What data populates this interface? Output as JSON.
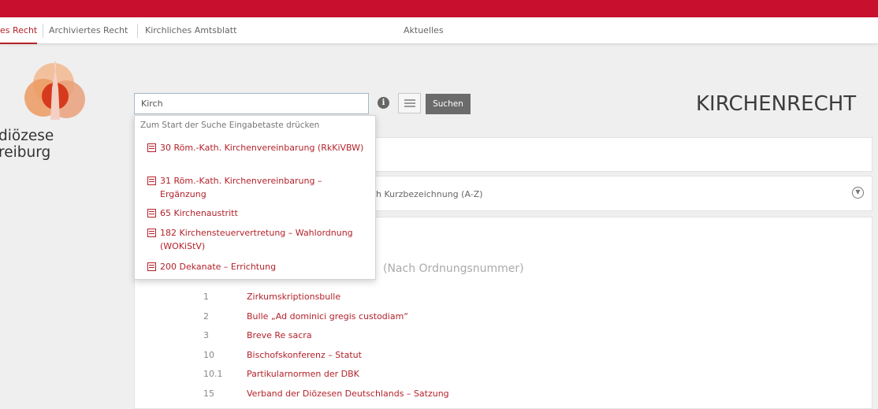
{
  "nav": {
    "items": [
      {
        "label": "es Recht",
        "active": true
      },
      {
        "label": "Archiviertes Recht",
        "active": false
      },
      {
        "label": "Kirchliches Amtsblatt",
        "active": false
      },
      {
        "label": "Aktuelles",
        "active": false
      }
    ]
  },
  "logo": {
    "line1": "diözese",
    "line2": "reiburg"
  },
  "search": {
    "value": "Kirch",
    "placeholder": "",
    "button_label": "Suchen",
    "info_icon": "info-icon",
    "list_icon": "list-icon"
  },
  "page_title": "KIRCHENRECHT",
  "sort_label": "h Kurzbezeichnung (A-Z)",
  "section_subtitle": "(Nach Ordnungsnummer)",
  "dropdown": {
    "hint": "Zum Start der Suche Eingabetaste drücken",
    "items": [
      {
        "label": "30 Röm.-Kath. Kirchenvereinbarung (RkKiVBW)"
      },
      {
        "label": "31 Röm.-Kath. Kirchenvereinbarung – Ergänzung"
      },
      {
        "label": "65 Kirchenaustritt"
      },
      {
        "label": "182 Kirchensteuervertretung – Wahlordnung (WOKiStV)"
      },
      {
        "label": "200 Dekanate – Errichtung"
      }
    ]
  },
  "laws": [
    {
      "num": "1",
      "title": "Zirkumskriptionsbulle"
    },
    {
      "num": "2",
      "title": "Bulle „Ad dominici gregis custodiam“"
    },
    {
      "num": "3",
      "title": "Breve Re sacra"
    },
    {
      "num": "10",
      "title": "Bischofskonferenz – Statut"
    },
    {
      "num": "10.1",
      "title": "Partikularnormen der DBK"
    },
    {
      "num": "15",
      "title": "Verband der Diözesen Deutschlands – Satzung"
    }
  ],
  "colors": {
    "accent": "#b3222a",
    "topbar": "#c8102e",
    "button": "#6b6b6b"
  }
}
